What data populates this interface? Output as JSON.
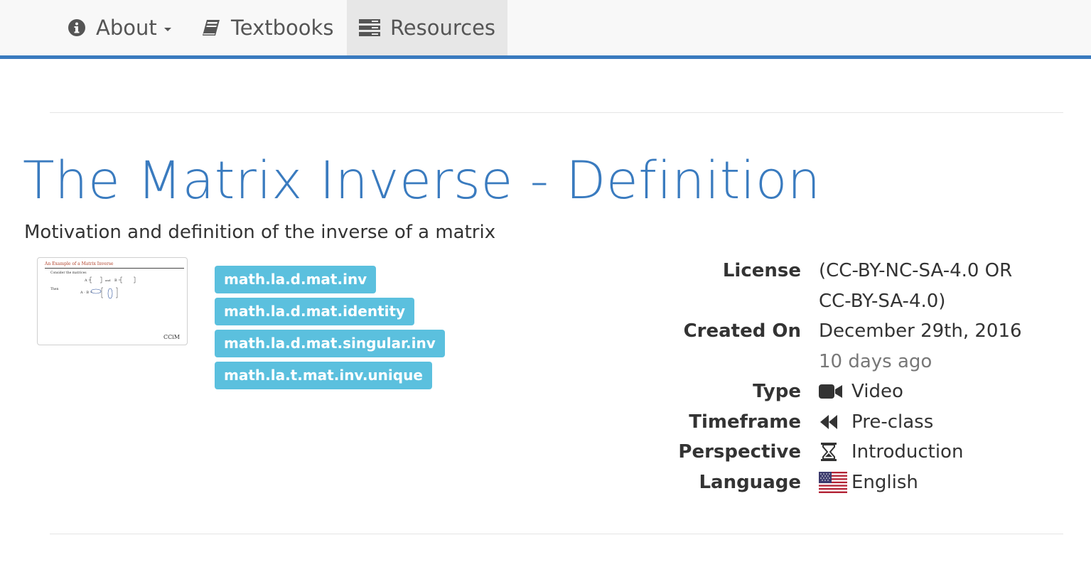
{
  "nav": {
    "items": [
      {
        "label": "About",
        "icon": "info-circle-icon",
        "has_caret": true
      },
      {
        "label": "Textbooks",
        "icon": "book-icon"
      },
      {
        "label": "Resources",
        "icon": "server-list-icon",
        "active": true
      }
    ]
  },
  "resource": {
    "title": "The Matrix Inverse - Definition",
    "description": "Motivation and definition of the inverse of a matrix",
    "thumbnail": {
      "heading": "An Example of a Matrix Inverse",
      "line1": "Consider the matrices",
      "line2": "Then",
      "logo": "CCiM"
    },
    "tags": [
      "math.la.d.mat.inv",
      "math.la.d.mat.identity",
      "math.la.d.mat.singular.inv",
      "math.la.t.mat.inv.unique"
    ],
    "info": {
      "license_label": "License",
      "license_line1": "(CC-BY-NC-SA-4.0 OR",
      "license_line2": "CC-BY-SA-4.0)",
      "created_label": "Created On",
      "created_date": "December 29th, 2016",
      "created_relative": "10 days ago",
      "type_label": "Type",
      "type_value": "Video",
      "type_icon": "video-camera-icon",
      "timeframe_label": "Timeframe",
      "timeframe_value": "Pre-class",
      "timeframe_icon": "backward-icon",
      "perspective_label": "Perspective",
      "perspective_value": "Introduction",
      "perspective_icon": "hourglass-icon",
      "language_label": "Language",
      "language_value": "English",
      "language_icon": "us-flag-icon"
    }
  },
  "colors": {
    "primary": "#3a7bbf",
    "tag": "#5bc0de",
    "navbar_bg": "#f8f8f8",
    "navbar_active": "#e7e7e7"
  }
}
